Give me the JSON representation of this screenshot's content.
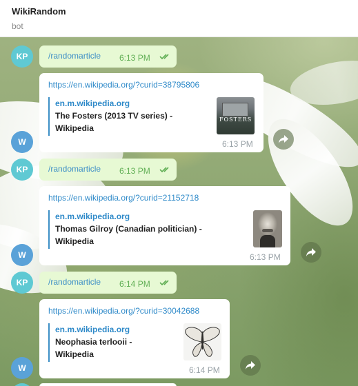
{
  "header": {
    "title": "WikiRandom",
    "subtitle": "bot"
  },
  "user": {
    "initials": "KP"
  },
  "bot": {
    "initials": "W"
  },
  "command": "/randomarticle",
  "messages": [
    {
      "sent_time": "6:13 PM",
      "url": "https://en.wikipedia.org/?curid=38795806",
      "site": "en.m.wikipedia.org",
      "title_line1": "The Fosters (2013 TV series) -",
      "title_line2": "Wikipedia",
      "thumb_text": "FOSTERS",
      "reply_time": "6:13 PM"
    },
    {
      "sent_time": "6:13 PM",
      "url": "https://en.wikipedia.org/?curid=21152718",
      "site": "en.m.wikipedia.org",
      "title_line1": "Thomas Gilroy (Canadian politician) -",
      "title_line2": "Wikipedia",
      "reply_time": "6:13 PM"
    },
    {
      "sent_time": "6:14 PM",
      "url": "https://en.wikipedia.org/?curid=30042688",
      "site": "en.m.wikipedia.org",
      "title_line1": "Neophasia terlooii -",
      "title_line2": "Wikipedia",
      "reply_time": "6:14 PM"
    }
  ],
  "icons": {
    "read": "double-check-icon",
    "share": "share-icon"
  },
  "colors": {
    "accent": "#3d8fc6",
    "outgoing": "#e7f9d4",
    "sent_time": "#5fae53"
  }
}
